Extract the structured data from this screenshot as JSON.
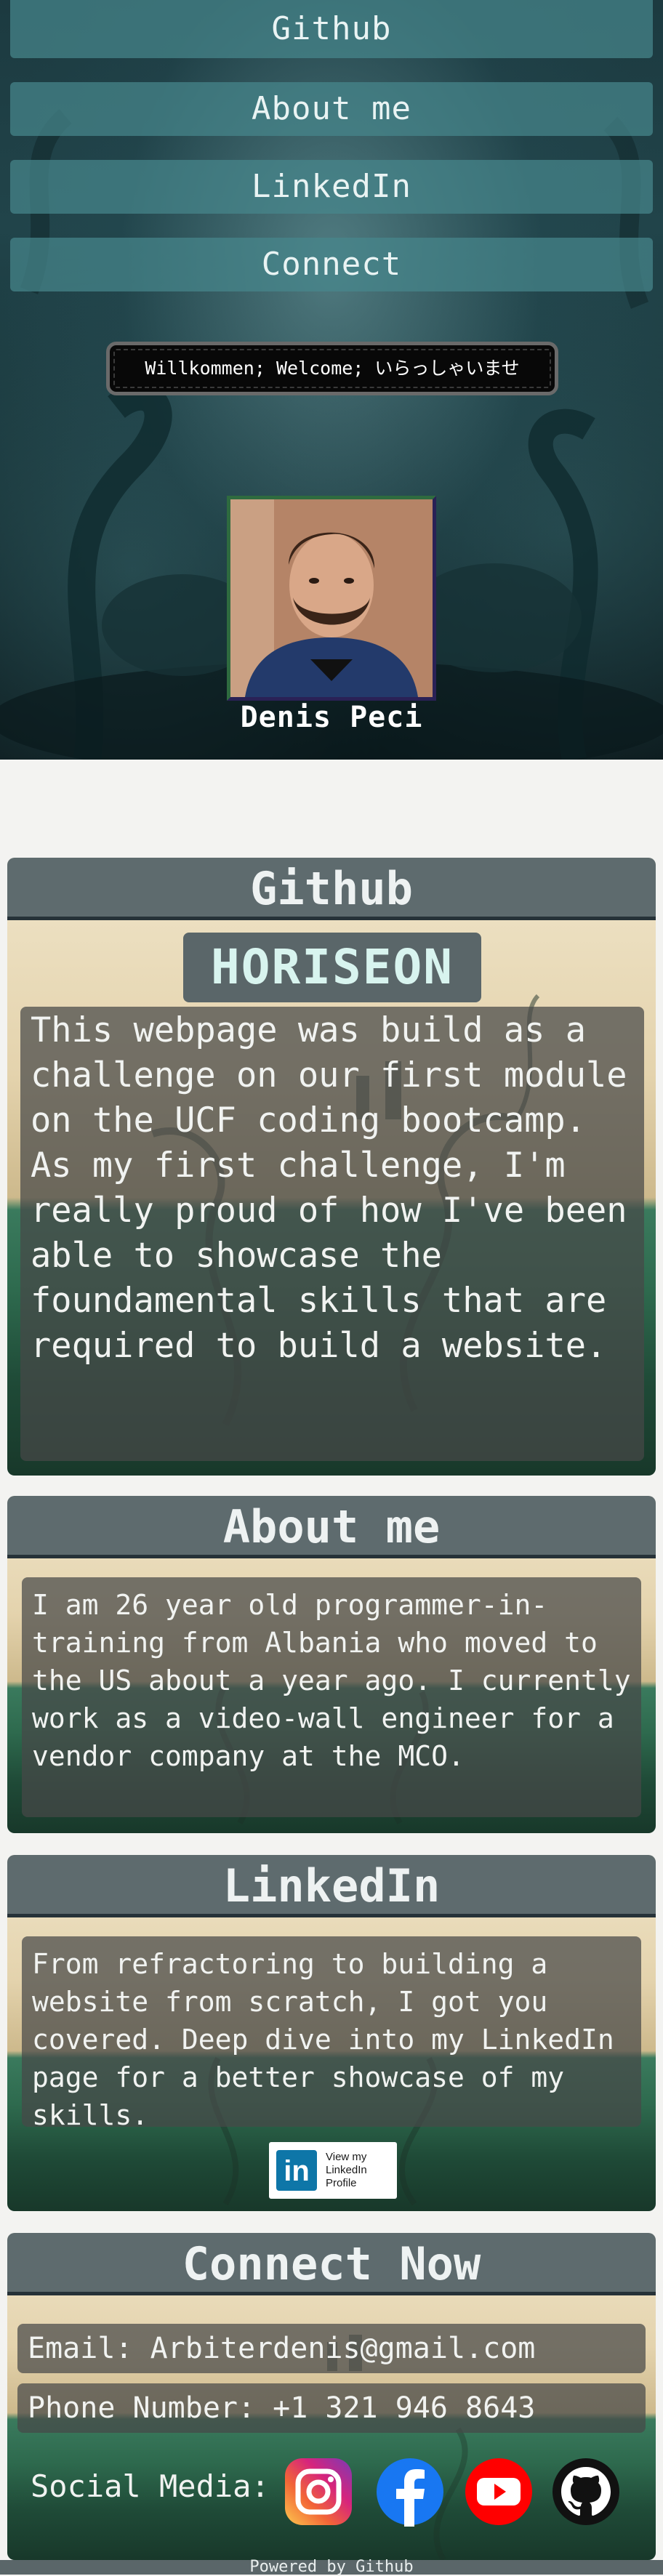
{
  "nav": {
    "items": [
      {
        "label": "Github"
      },
      {
        "label": "About me"
      },
      {
        "label": "LinkedIn"
      },
      {
        "label": "Connect"
      }
    ]
  },
  "hero": {
    "welcome": "Willkommen; Welcome; いらっしゃいませ",
    "name": "Denis Peci"
  },
  "github": {
    "title": "Github",
    "project": "HORISEON",
    "description": "This webpage was build as a challenge on our first module on the UCF coding bootcamp. As my first challenge, I'm really proud of how I've been able to showcase the foundamental skills that are required to build a website."
  },
  "about": {
    "title": "About me",
    "text": "I am 26 year old programmer-in-training from Albania who moved to the US about a year ago. I currently work as a video-wall engineer for a vendor company at the MCO."
  },
  "linkedin": {
    "title": "LinkedIn",
    "text": "From refractoring to building a website from scratch, I got you covered. Deep dive into my LinkedIn page for a better showcase of my skills.",
    "badge_logo": "in",
    "badge_lines": [
      "View my",
      "LinkedIn",
      "Profile"
    ]
  },
  "connect": {
    "title": "Connect Now",
    "email": "Email: Arbiterdenis@gmail.com",
    "phone": "Phone Number: +1 321 946 8643",
    "social_label": "Social Media:",
    "icons": [
      "instagram-icon",
      "facebook-icon",
      "youtube-icon",
      "github-icon"
    ]
  },
  "footer": "Powered by Github",
  "colors": {
    "nav_button": "#46878c",
    "section_header": "#5e6b6e",
    "card_overlay": "#464848",
    "horiseon_text": "#d8f4ef",
    "linkedin_blue": "#0e76a8",
    "facebook_blue": "#1877f2",
    "youtube_red": "#ff0000"
  }
}
